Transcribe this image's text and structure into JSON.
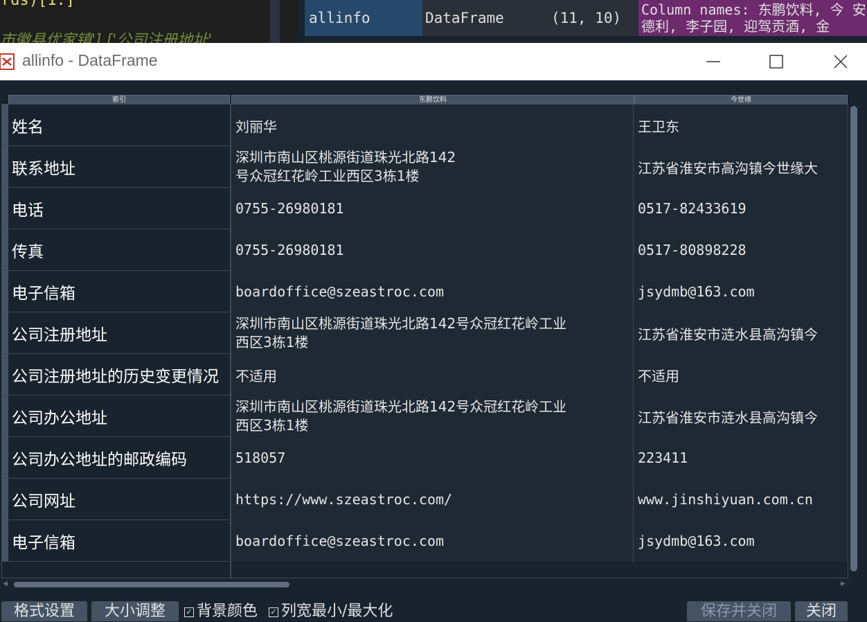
{
  "background": {
    "code_line1": "rds)[1:]",
    "code_line2": "市徽县优家镇'],['公司注册地址'",
    "var_name": "allinfo",
    "var_type": "DataFrame",
    "var_size": "(11, 10)",
    "var_value": "Column names: 东鹏饮料, 今 安德利, 李子园, 迎驾贡酒, 金"
  },
  "window": {
    "title": "allinfo - DataFrame"
  },
  "grid": {
    "headers": [
      "索引",
      "东鹏饮料",
      "今世缘"
    ],
    "index_labels": [
      "姓名",
      "联系地址",
      "电话",
      "传真",
      "电子信箱",
      "公司注册地址",
      "公司注册地址的历史变更情况",
      "公司办公地址",
      "公司办公地址的邮政编码",
      "公司网址",
      "电子信箱"
    ],
    "col1": [
      "刘丽华",
      "深圳市南山区桃源街道珠光北路142号众冠红花岭工业西区3栋1楼",
      "0755-26980181",
      "0755-26980181",
      "boardoffice@szeastroc.com",
      "深圳市南山区桃源街道珠光北路142号众冠红花岭工业西区3栋1楼",
      "不适用",
      "深圳市南山区桃源街道珠光北路142号众冠红花岭工业西区3栋1楼",
      "518057",
      "https://www.szeastroc.com/",
      "boardoffice@szeastroc.com"
    ],
    "col2": [
      "王卫东",
      "江苏省淮安市高沟镇今世缘大",
      "0517-82433619",
      "0517-80898228",
      "jsydmb@163.com",
      "江苏省淮安市涟水县高沟镇今",
      "不适用",
      "江苏省淮安市涟水县高沟镇今",
      "223411",
      "www.jinshiyuan.com.cn",
      "jsydmb@163.com"
    ],
    "col1_row2_lines": [
      "深圳市南山区桃源街道珠光北路142",
      "号众冠红花岭工业西区3栋1楼"
    ],
    "col1_wrap_lines": [
      "深圳市南山区桃源街道珠光北路142号众冠红花岭工业",
      "西区3栋1楼"
    ]
  },
  "toolbar": {
    "format_label": "格式设置",
    "resize_label": "大小调整",
    "bg_color_label": "背景颜色",
    "col_width_label": "列宽最小/最大化",
    "save_close_label": "保存并关闭",
    "close_label": "关闭"
  },
  "colors": {
    "accent": "#26486b",
    "value_bg": "#6d2a6d",
    "grid_bg": "#19232d"
  }
}
